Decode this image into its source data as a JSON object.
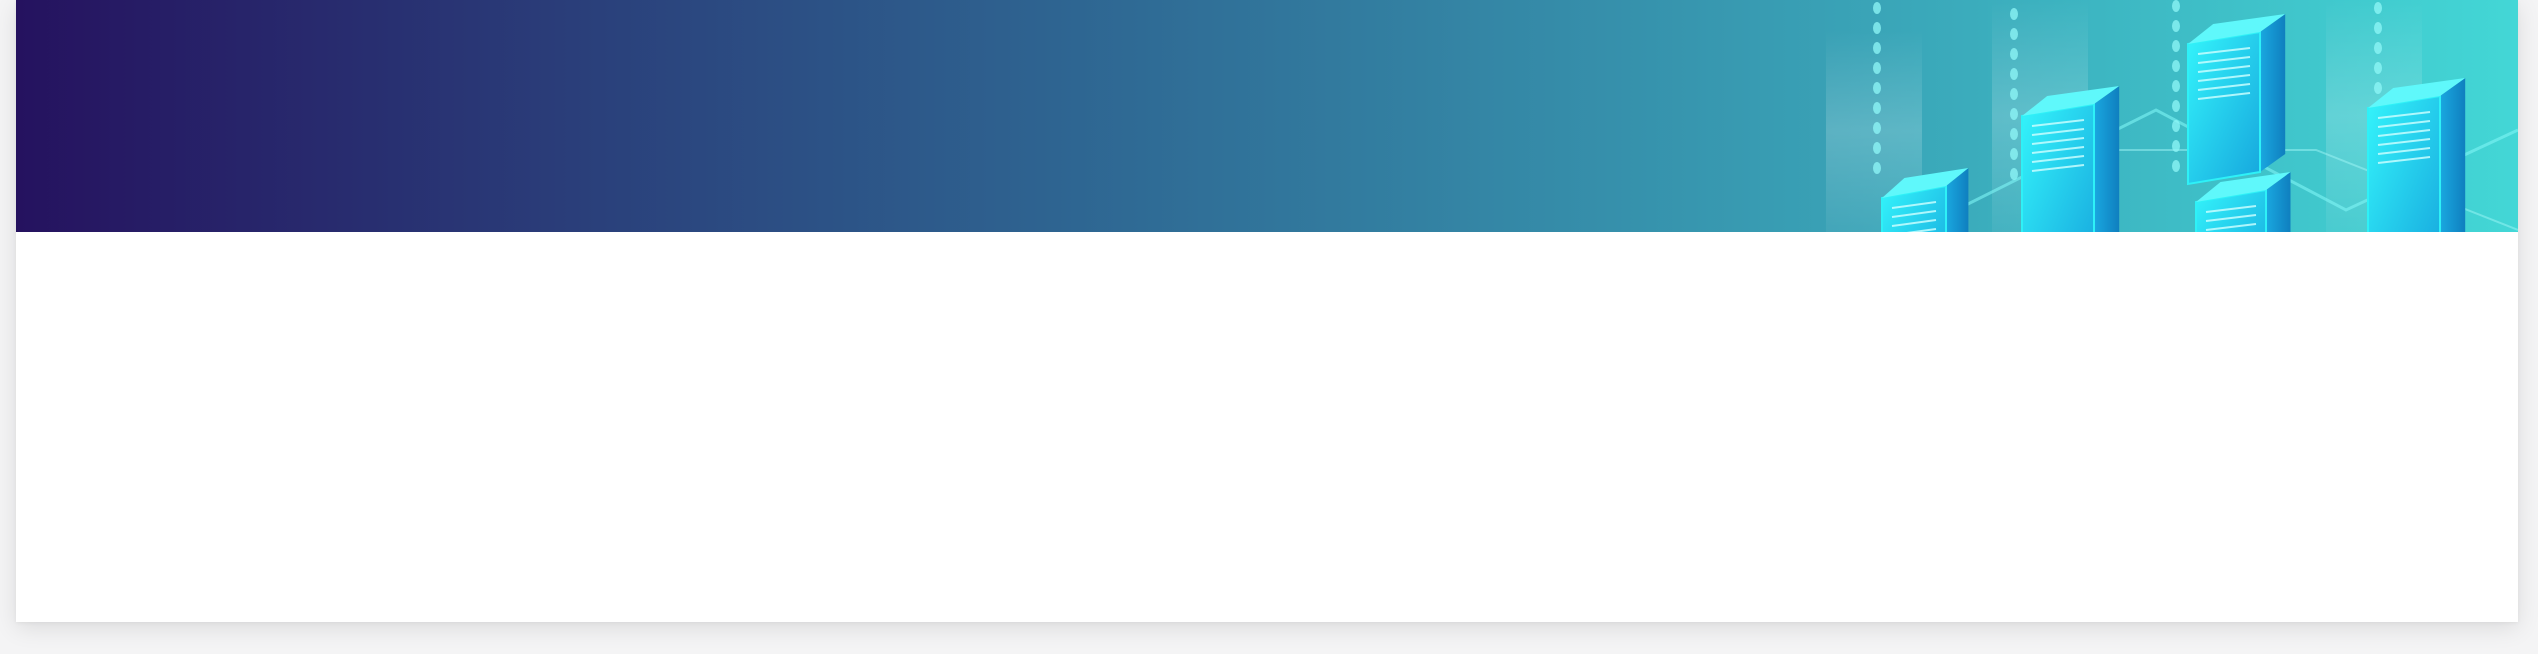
{
  "banner": {
    "gradient_start": "#25125f",
    "gradient_mid": "#2f6b95",
    "gradient_end": "#43d7d6",
    "illustration": "isometric-server-racks",
    "rack_glow": "#2ef1f7",
    "rack_dark": "#1690c9"
  },
  "content": {
    "text": ""
  }
}
